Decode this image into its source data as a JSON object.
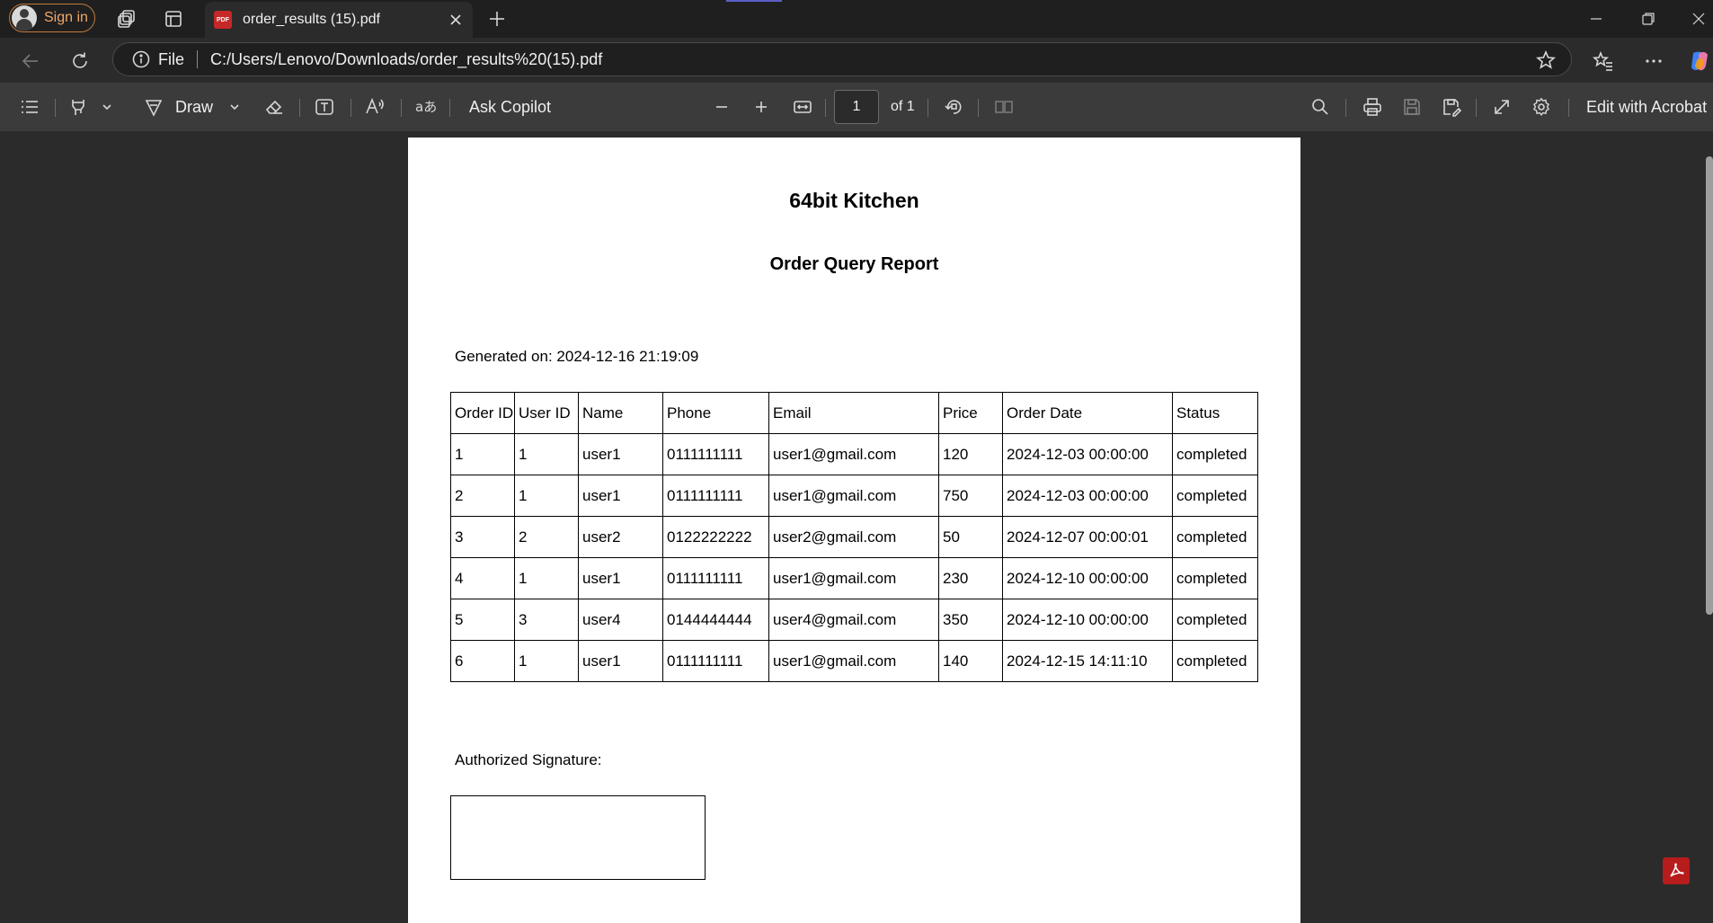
{
  "tabstrip": {
    "signin_label": "Sign in",
    "tab_title": "order_results (15).pdf",
    "tab_favicon": "PDF"
  },
  "address": {
    "file_label": "File",
    "url": "C:/Users/Lenovo/Downloads/order_results%20(15).pdf"
  },
  "toolbar": {
    "draw_label": "Draw",
    "ask_copilot_label": "Ask Copilot",
    "page_number": "1",
    "page_total": "of 1",
    "edit_acrobat_label": "Edit with Acrobat"
  },
  "document": {
    "title": "64bit Kitchen",
    "subtitle": "Order Query Report",
    "generated": "Generated on: 2024-12-16 21:19:09",
    "table": {
      "headers": [
        "Order ID",
        "User ID",
        "Name",
        "Phone",
        "Email",
        "Price",
        "Order Date",
        "Status"
      ],
      "rows": [
        [
          "1",
          "1",
          "user1",
          "0111111111",
          "user1@gmail.com",
          "120",
          "2024-12-03 00:00:00",
          "completed"
        ],
        [
          "2",
          "1",
          "user1",
          "0111111111",
          "user1@gmail.com",
          "750",
          "2024-12-03 00:00:00",
          "completed"
        ],
        [
          "3",
          "2",
          "user2",
          "0122222222",
          "user2@gmail.com",
          "50",
          "2024-12-07 00:00:01",
          "completed"
        ],
        [
          "4",
          "1",
          "user1",
          "0111111111",
          "user1@gmail.com",
          "230",
          "2024-12-10 00:00:00",
          "completed"
        ],
        [
          "5",
          "3",
          "user4",
          "0144444444",
          "user4@gmail.com",
          "350",
          "2024-12-10 00:00:00",
          "completed"
        ],
        [
          "6",
          "1",
          "user1",
          "0111111111",
          "user1@gmail.com",
          "140",
          "2024-12-15 14:11:10",
          "completed"
        ]
      ]
    },
    "signature_label": "Authorized Signature:"
  },
  "colors": {
    "tabstrip_bg": "#1f1f1f",
    "toolbar_bg": "#3b3b3b",
    "viewer_bg": "#2b2b2b",
    "signin_accent": "#f0a868",
    "acrobat_red": "#b71c1c"
  }
}
